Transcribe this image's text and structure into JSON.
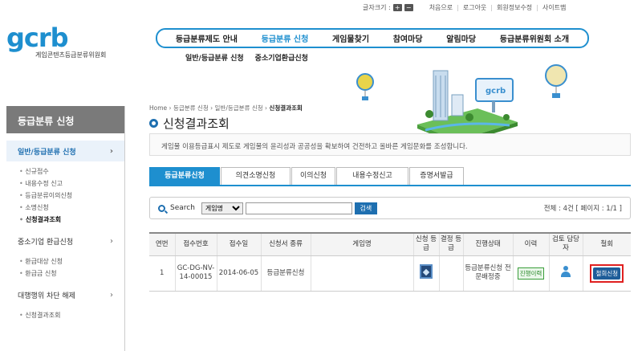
{
  "util": {
    "font_size_label": "글자크기 :",
    "font_plus": "+",
    "font_minus": "−",
    "links": [
      "처음으로",
      "로그아웃",
      "회원정보수정",
      "사이트맵"
    ]
  },
  "logo": {
    "mark": "gcrb",
    "subtitle": "게임콘텐츠등급분류위원회"
  },
  "gnb": {
    "items": [
      "등급분류제도 안내",
      "등급분류 신청",
      "게임물찾기",
      "참여마당",
      "알림마당",
      "등급분류위원회 소개"
    ],
    "active_index": 1
  },
  "subnav": [
    "일반/등급분류 신청",
    "중소기업환급신청"
  ],
  "sidebar": {
    "title": "등급분류 신청",
    "menus": [
      {
        "label": "일반/등급분류 신청",
        "chevron": "›",
        "sub": [
          "신규접수",
          "내용수정 신고",
          "등급분류이의신청",
          "소명신청",
          "신청결과조회"
        ]
      },
      {
        "label": "중소기업 환급신청",
        "chevron": "›",
        "sub": [
          "환급대상 신청",
          "환급금 신청"
        ]
      },
      {
        "label": "대행행위 차단 해제",
        "chevron": "›",
        "sub": [
          "신청결과조회"
        ]
      }
    ]
  },
  "breadcrumb": [
    "Home",
    "등급분류 신청",
    "일반/등급분류 신청",
    "신청결과조회"
  ],
  "page_title": "신청결과조회",
  "intro_text": "게임물 이용등급표시 제도로 게임물의 윤리성과 공공성을 확보하여 건전하고 올바른 게임문화를 조성합니다.",
  "tabs": [
    "등급분류신청",
    "의견소명신청",
    "이의신청",
    "내용수정신고",
    "증명서발급"
  ],
  "search": {
    "label": "Search",
    "select_value": "게임명",
    "input_value": "",
    "button_label": "검색",
    "count_text": "전체 : 4건 [ 페이지 : 1/1 ]"
  },
  "table": {
    "headers": [
      "연번",
      "접수번호",
      "접수일",
      "신청서 종류",
      "게임명",
      "신청 등급",
      "결정 등급",
      "진행상태",
      "이력",
      "검토 담당자",
      "철회"
    ],
    "rows": [
      {
        "no": "1",
        "receipt_no": "GC-DG-NV-14-00015",
        "date": "2014-06-05",
        "form_type": "등급분류신청",
        "game_name": "",
        "decision_rating": "",
        "status": "등급분류신청 전문배정중",
        "history_label": "진행이력",
        "withdraw_label": "철회신청"
      }
    ]
  },
  "colors": {
    "brand": "#1e8fcf",
    "accent_dark": "#1e5d99",
    "highlight": "#e02020",
    "status_green": "#2d8b2d"
  }
}
